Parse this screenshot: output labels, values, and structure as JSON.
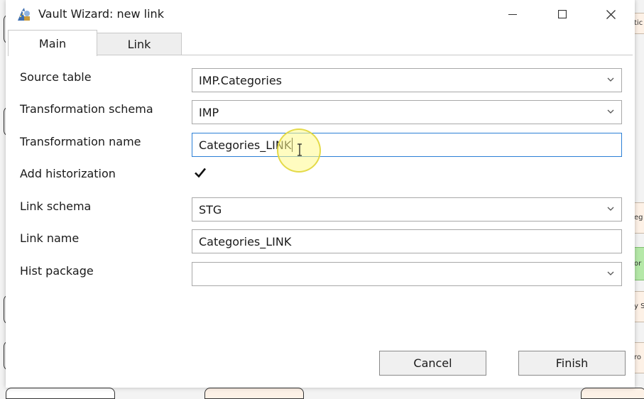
{
  "window": {
    "title": "Vault Wizard: new link",
    "icon": "wizard-app-icon",
    "controls": [
      "minimize-icon",
      "maximize-icon",
      "close-icon"
    ]
  },
  "tabs": [
    {
      "label": "Main",
      "selected": true
    },
    {
      "label": "Link",
      "selected": false
    }
  ],
  "form": {
    "source_table": {
      "label": "Source table",
      "value": "IMP.Categories"
    },
    "transformation_schema": {
      "label": "Transformation schema",
      "value": "IMP"
    },
    "transformation_name": {
      "label": "Transformation name",
      "value": "Categories_LINK"
    },
    "add_historization": {
      "label": "Add historization",
      "checked": true
    },
    "link_schema": {
      "label": "Link schema",
      "value": "STG"
    },
    "link_name": {
      "label": "Link name",
      "value": "Categories_LINK"
    },
    "hist_package": {
      "label": "Hist package",
      "value": ""
    }
  },
  "buttons": {
    "cancel": "Cancel",
    "finish": "Finish"
  },
  "background_fragments": [
    "tic",
    "eg",
    "or",
    "y S",
    "ro"
  ],
  "colors": {
    "focus_border": "#2b7fd6",
    "field_border": "#a8a8a8",
    "highlight_green": "#b5e8a8",
    "card_bg": "#fdf1e6"
  }
}
